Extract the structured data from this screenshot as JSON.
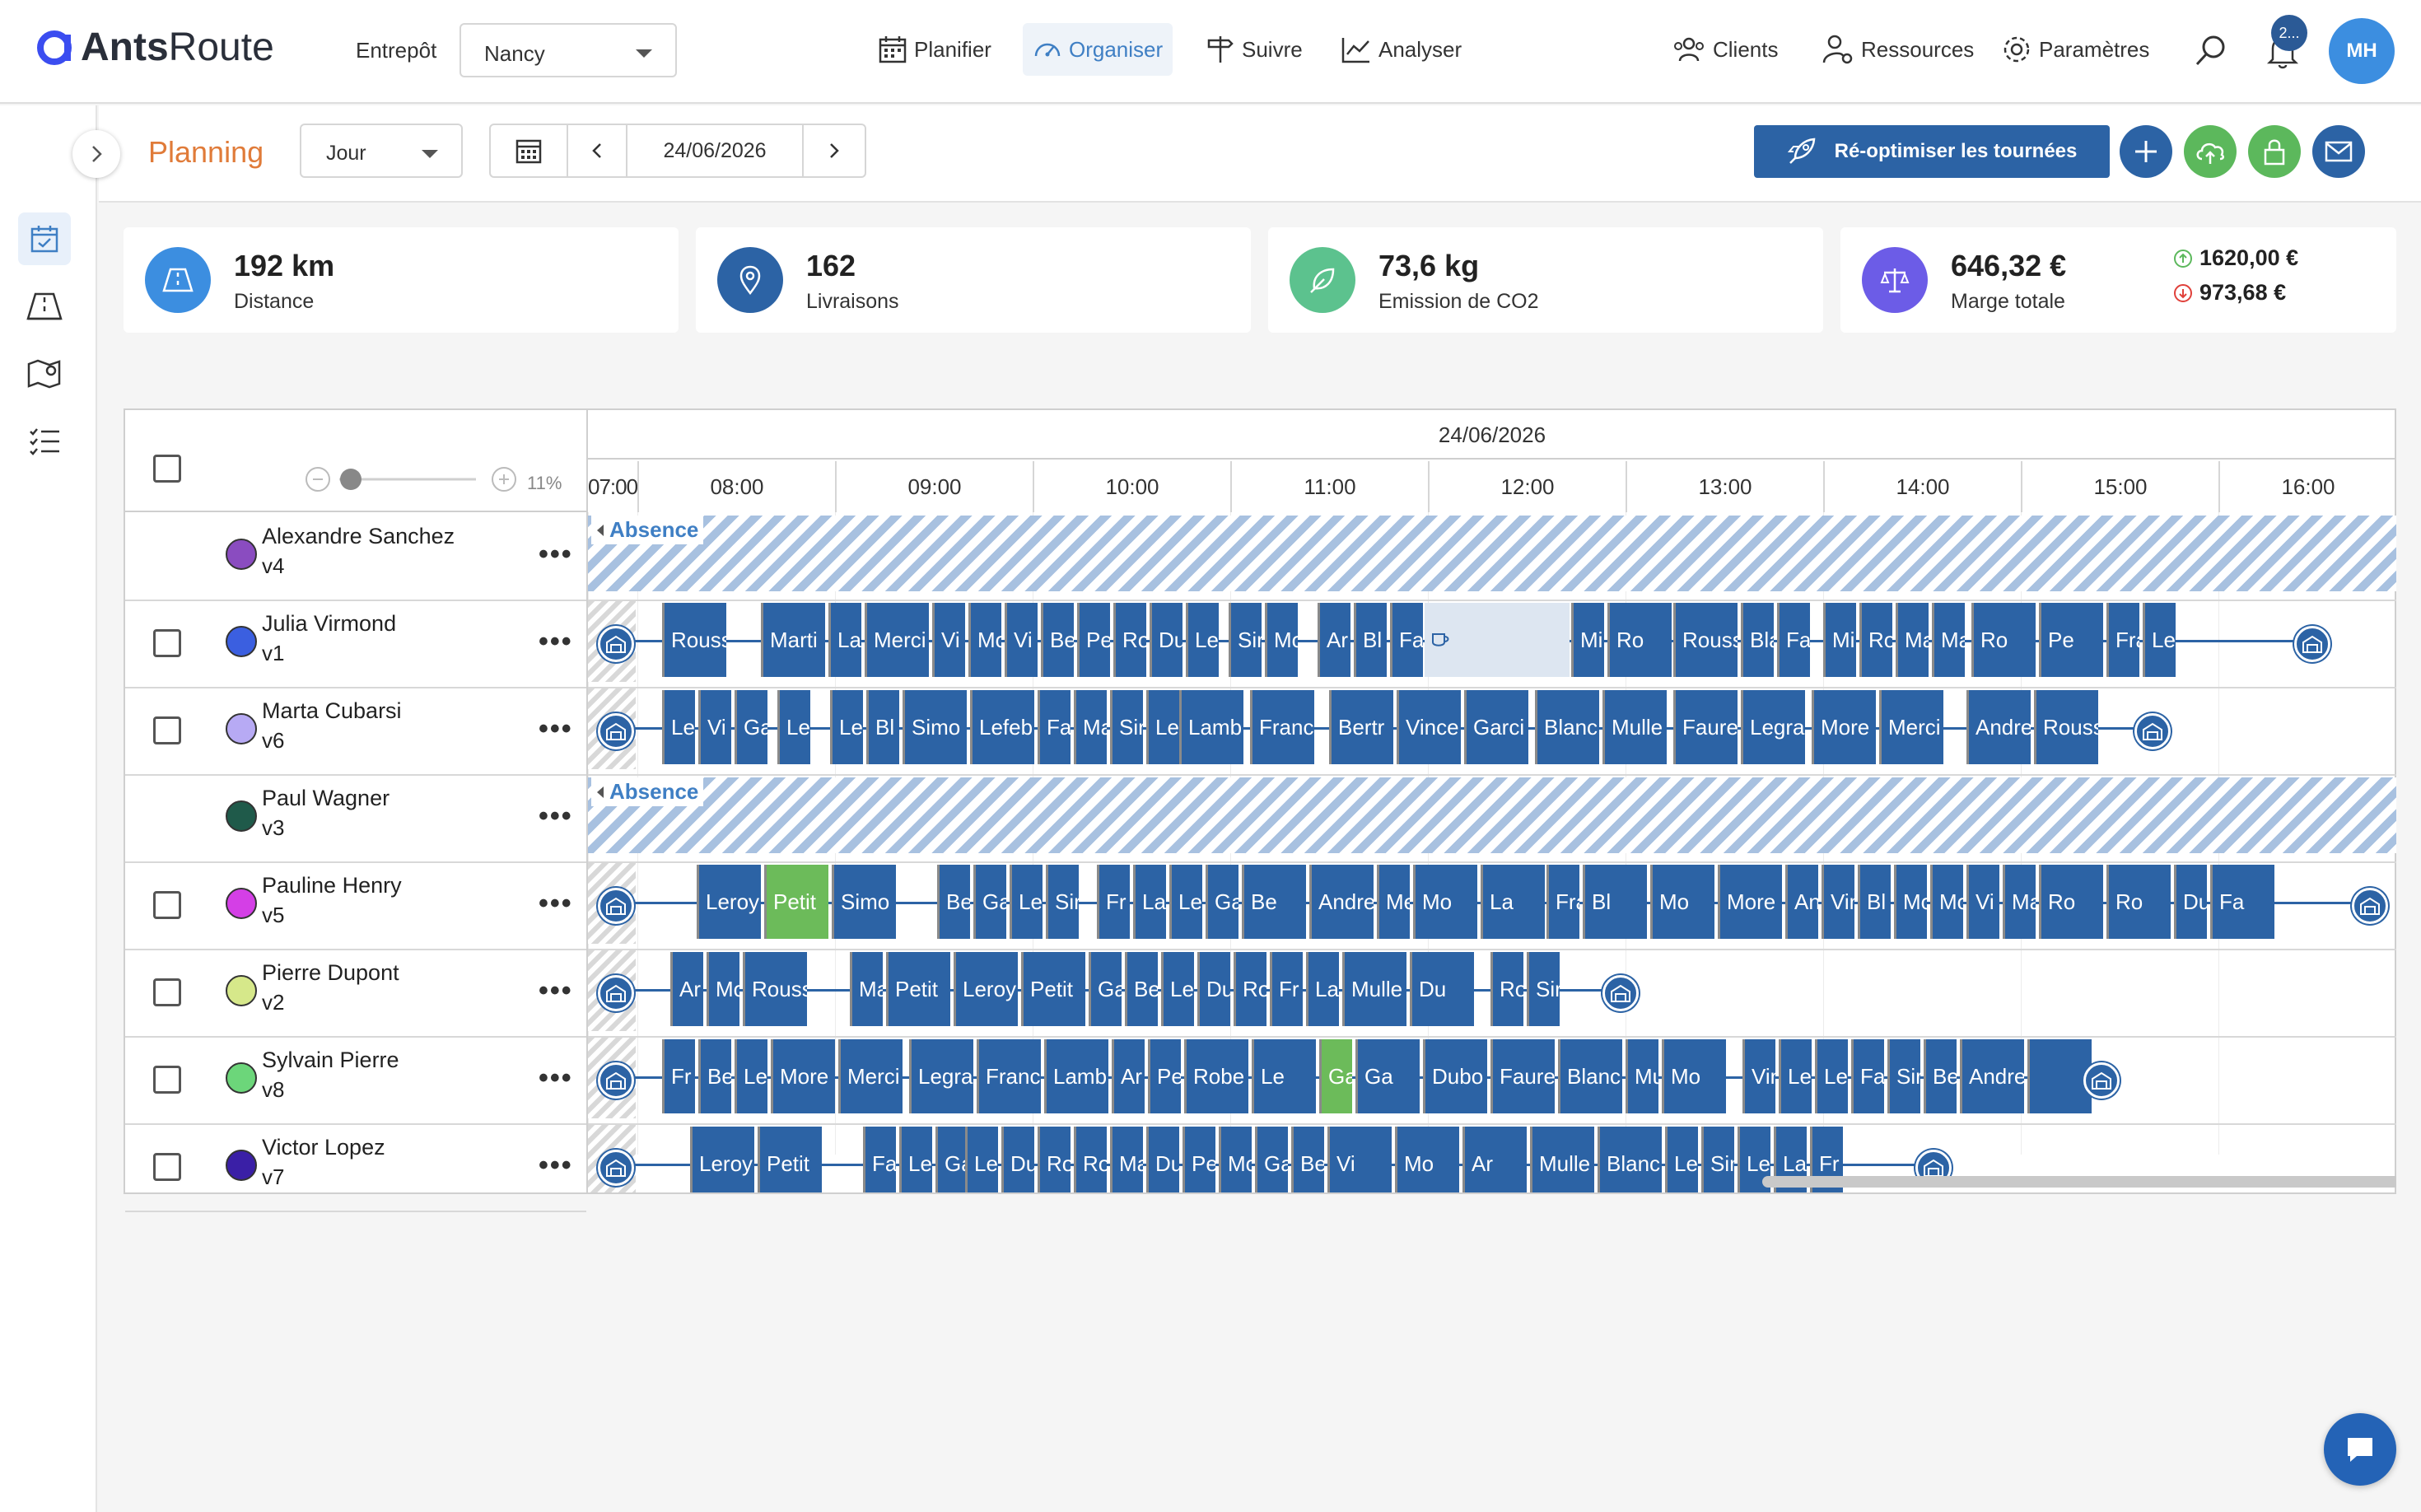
{
  "app": {
    "logo_a": "Ants",
    "logo_b": "Route"
  },
  "nav": {
    "warehouse_label": "Entrepôt",
    "warehouse_value": "Nancy",
    "items": [
      {
        "label": "Planifier",
        "icon": "calendar-icon"
      },
      {
        "label": "Organiser",
        "icon": "gauge-icon",
        "active": true
      },
      {
        "label": "Suivre",
        "icon": "signpost-icon"
      },
      {
        "label": "Analyser",
        "icon": "chart-icon"
      }
    ],
    "right": [
      {
        "label": "Clients",
        "icon": "users-icon"
      },
      {
        "label": "Ressources",
        "icon": "user-gear-icon"
      },
      {
        "label": "Paramètres",
        "icon": "gear-icon"
      }
    ],
    "notifications_badge": "2...",
    "avatar_initials": "MH"
  },
  "header": {
    "title": "Planning",
    "view": "Jour",
    "date": "24/06/2026",
    "reoptimize_label": "Ré-optimiser les tournées"
  },
  "kpis": {
    "distance": {
      "value": "192 km",
      "label": "Distance"
    },
    "deliveries": {
      "value": "162",
      "label": "Livraisons"
    },
    "co2": {
      "value": "73,6 kg",
      "label": "Emission de CO2"
    },
    "margin": {
      "value": "646,32 €",
      "label": "Marge totale",
      "up": "1620,00 €",
      "down": "973,68 €"
    }
  },
  "planning": {
    "date": "24/06/2026",
    "zoom": "11%",
    "absence_label": "Absence",
    "hours": [
      "07:00",
      "08:00",
      "09:00",
      "10:00",
      "11:00",
      "12:00",
      "13:00",
      "14:00",
      "15:00",
      "16:00"
    ],
    "drivers": [
      {
        "name": "Alexandre Sanchez",
        "vehicle": "v4",
        "color": "#8a4cc0",
        "checkbox": false,
        "absence": true
      },
      {
        "name": "Julia Virmond",
        "vehicle": "v1",
        "color": "#3b5fe0",
        "checkbox": true,
        "absence": false
      },
      {
        "name": "Marta Cubarsi",
        "vehicle": "v6",
        "color": "#b7aaf4",
        "checkbox": true,
        "absence": false
      },
      {
        "name": "Paul Wagner",
        "vehicle": "v3",
        "color": "#1f5a4a",
        "checkbox": false,
        "absence": true
      },
      {
        "name": "Pauline Henry",
        "vehicle": "v5",
        "color": "#d43fe6",
        "checkbox": true,
        "absence": false
      },
      {
        "name": "Pierre Dupont",
        "vehicle": "v2",
        "color": "#d6e88a",
        "checkbox": true,
        "absence": false
      },
      {
        "name": "Sylvain Pierre",
        "vehicle": "v8",
        "color": "#6cd67a",
        "checkbox": true,
        "absence": false
      },
      {
        "name": "Victor Lopez",
        "vehicle": "v7",
        "color": "#3a1fa6",
        "checkbox": true,
        "absence": false
      }
    ]
  },
  "colors": {
    "primary": "#2c63a5",
    "accent": "#e07b39",
    "green": "#6cbb5a",
    "distance": "#3c8ee0",
    "co2": "#5cc28e",
    "margin": "#6c5ce7"
  }
}
